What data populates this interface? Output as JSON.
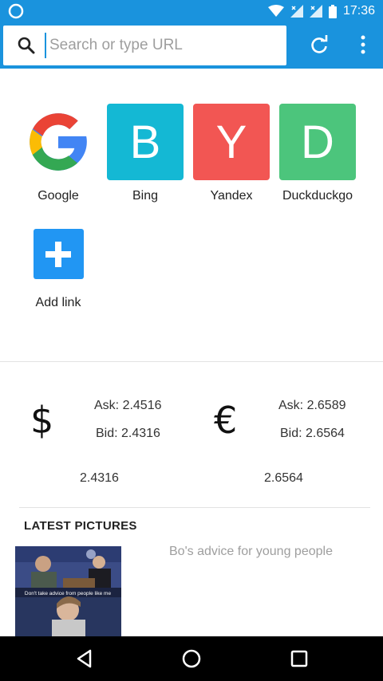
{
  "status_bar": {
    "time": "17:36"
  },
  "toolbar": {
    "url_placeholder": "Search or type URL",
    "url_value": ""
  },
  "speed_dial": [
    {
      "label": "Google",
      "letter": "",
      "color": "#ffffff"
    },
    {
      "label": "Bing",
      "letter": "B",
      "color": "#14b8d4"
    },
    {
      "label": "Yandex",
      "letter": "Y",
      "color": "#f25653"
    },
    {
      "label": "Duckduckgo",
      "letter": "D",
      "color": "#4cc57c"
    }
  ],
  "add_link": {
    "label": "Add link",
    "color": "#2196f3"
  },
  "currency": {
    "usd": {
      "symbol": "$",
      "ask": "Ask: 2.4516",
      "bid": "Bid: 2.4316",
      "rate": "2.4316"
    },
    "eur": {
      "symbol": "€",
      "ask": "Ask: 2.6589",
      "bid": "Bid: 2.6564",
      "rate": "2.6564"
    }
  },
  "latest_pictures": {
    "title": "LATEST PICTURES",
    "items": [
      {
        "caption": "Bo's advice for young people",
        "image_text": "Don't take advice from people like me"
      }
    ]
  },
  "colors": {
    "accent": "#1a93dd"
  }
}
